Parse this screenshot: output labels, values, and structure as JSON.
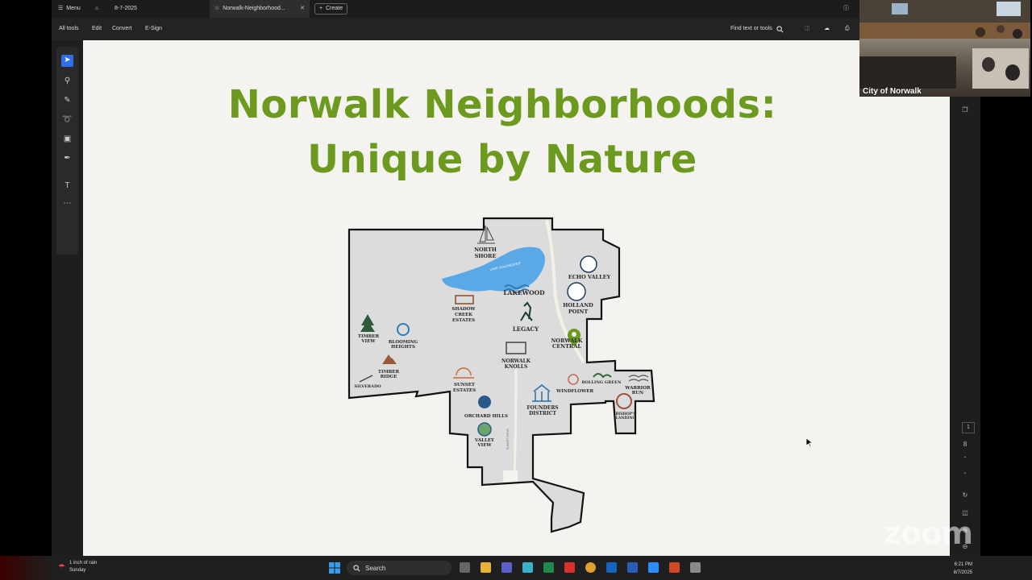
{
  "tabbar": {
    "menu_label": "Menu",
    "doc1_label": "8-7-2025",
    "doc2_label": "Norwalk-Neighborhood...",
    "create_label": "Create"
  },
  "toolbar": {
    "all_tools": "All tools",
    "edit": "Edit",
    "convert": "Convert",
    "esign": "E-Sign",
    "find": "Find text or tools"
  },
  "slide": {
    "title_line1": "Norwalk Neighborhoods:",
    "title_line2": "Unique by Nature"
  },
  "map": {
    "lake_label": "LAKE COLCHESTER",
    "road_label": "SUNSET DRIVE",
    "neighborhoods": {
      "north_shore_1": "NORTH",
      "north_shore_2": "SHORE",
      "echo_valley": "ECHO VALLEY",
      "lakewood": "LAKEWOOD",
      "holland_point_1": "HOLLAND",
      "holland_point_2": "POINT",
      "shadow_creek_1": "SHADOW",
      "shadow_creek_2": "CREEK",
      "shadow_creek_3": "ESTATES",
      "legacy": "LEGACY",
      "norwalk_central_1": "NORWALK",
      "norwalk_central_2": "CENTRAL",
      "timber_view_1": "TIMBER",
      "timber_view_2": "VIEW",
      "blooming_heights_1": "BLOOMING",
      "blooming_heights_2": "HEIGHTS",
      "norwalk_knolls_1": "NORWALK",
      "norwalk_knolls_2": "KNOLLS",
      "timber_ridge_1": "TIMBER",
      "timber_ridge_2": "RIDGE",
      "silverado": "SILVERADO",
      "sunset_estates_1": "SUNSET",
      "sunset_estates_2": "ESTATES",
      "rolling_green": "ROLLING GREEN",
      "windflower": "WINDFLOWER",
      "warrior_run_1": "WARRIOR",
      "warrior_run_2": "RUN",
      "founders_1": "FOUNDERS",
      "founders_2": "DISTRICT",
      "orchard_hills": "ORCHARD HILLS",
      "bishops_1": "BISHOP'S",
      "bishops_2": "LANDING",
      "valley_view_1": "VALLEY",
      "valley_view_2": "VIEW"
    }
  },
  "right_rail": {
    "page_current": "1",
    "page_total": "8"
  },
  "webcam": {
    "caption": "City of Norwalk"
  },
  "zoom_watermark": "zoom",
  "taskbar": {
    "weather_line1": "1 inch of rain",
    "weather_line2": "Sunday",
    "search_label": "Search",
    "time": "6:21 PM",
    "date": "8/7/2025"
  },
  "colors": {
    "title_green": "#6b9a1f",
    "lake_blue": "#5aa9e6",
    "acrobat_accent": "#2f6fea"
  }
}
